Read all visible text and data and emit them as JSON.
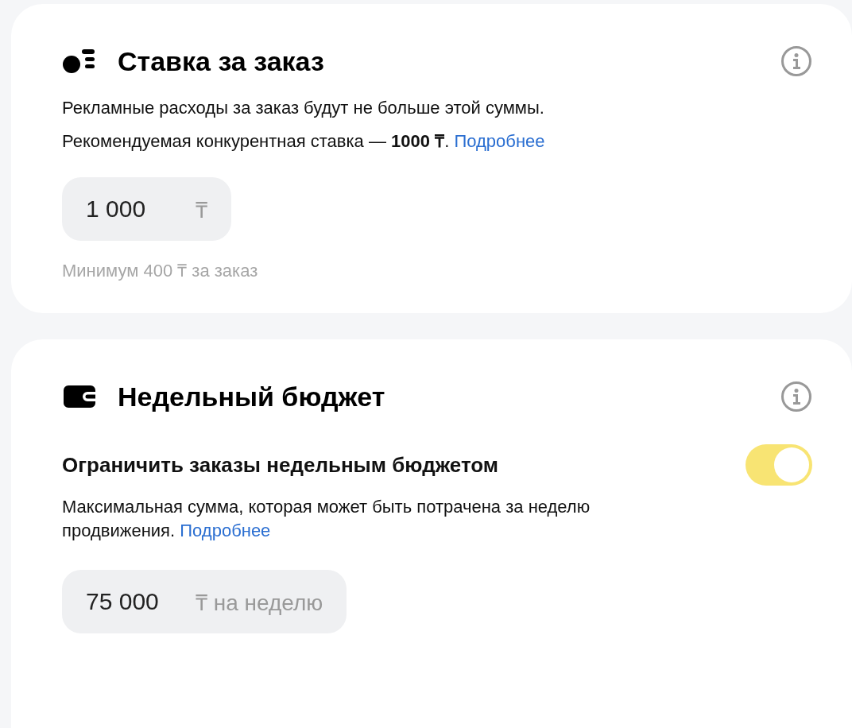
{
  "sections": [
    {
      "kind": "bid",
      "title": "Ставка за заказ",
      "paragraphs": [
        {
          "text": "Рекламные расходы за заказ будут не больше этой суммы."
        },
        {
          "text": "Рекомендуемая конкурентная ставка — **1000 ₸**.",
          "link": "Подробнее"
        }
      ],
      "field": {
        "value": "1 000",
        "suffix": "₸",
        "hint": "Минимум 400 ₸ за заказ"
      }
    },
    {
      "kind": "budget",
      "title": "Недельный бюджет",
      "toggle": {
        "label": "Ограничить заказы недельным бюджетом",
        "on": true
      },
      "paragraphs": [
        {
          "text": "Максимальная сумма, которая может быть потрачена за неделю продвижения.",
          "link": "Подробнее"
        }
      ],
      "field": {
        "value": "75 000",
        "suffix": "₸ на неделю"
      }
    }
  ]
}
